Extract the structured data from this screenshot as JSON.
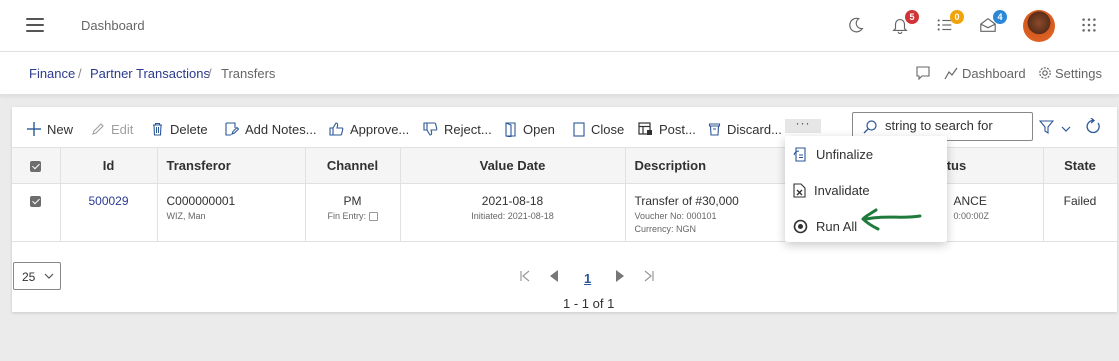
{
  "header": {
    "title": "Dashboard",
    "notifications_count": "5",
    "tasks_count": "0",
    "messages_count": "4",
    "badge_colors": {
      "notifications": "#d13438",
      "tasks": "#f0a30a",
      "messages": "#2b88d8"
    }
  },
  "breadcrumb": {
    "items": [
      "Finance",
      "Partner Transactions",
      "Transfers"
    ],
    "separator": "/"
  },
  "page_actions": {
    "dashboard": "Dashboard",
    "settings": "Settings"
  },
  "toolbar": {
    "new": "New",
    "edit": "Edit",
    "delete": "Delete",
    "add_notes": "Add Notes...",
    "approve": "Approve...",
    "reject": "Reject...",
    "open": "Open",
    "close": "Close",
    "post": "Post...",
    "discard": "Discard...",
    "more": "···",
    "search_value": "string to search for"
  },
  "table": {
    "columns": [
      "Id",
      "Transferor",
      "Channel",
      "Value Date",
      "Description",
      "atus",
      "State"
    ],
    "row": {
      "id": "500029",
      "transferor": "C000000001",
      "transferor_sub": "WIZ, Man",
      "channel": "PM",
      "channel_sub": "Fin Entry:",
      "value_date": "2021-08-18",
      "value_date_sub": "Initiated: 2021-08-18",
      "description": "Transfer of #30,000",
      "voucher": "Voucher No: 000101",
      "currency": "Currency: NGN",
      "status": "ANCE",
      "status_sub": "0:00:00Z",
      "state": "Failed"
    }
  },
  "pager": {
    "page_size": "25",
    "current_page": "1",
    "count_text": "1 - 1 of 1"
  },
  "menu": {
    "unfinalize": "Unfinalize",
    "invalidate": "Invalidate",
    "run_all": "Run All"
  },
  "colors": {
    "link": "#2b3a8f",
    "annotation": "#1f7a3c"
  }
}
